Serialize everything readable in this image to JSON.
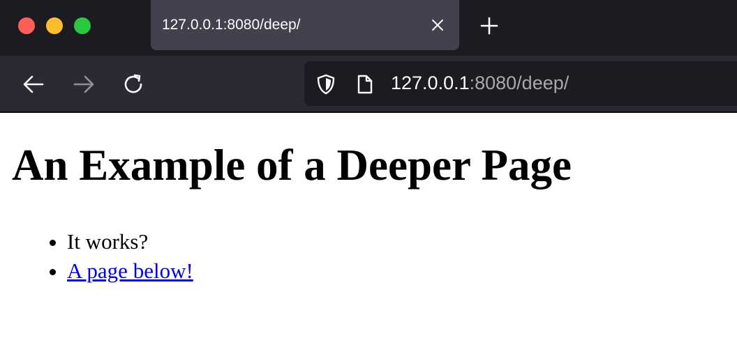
{
  "browser": {
    "tab": {
      "title": "127.0.0.1:8080/deep/"
    },
    "url": {
      "host": "127.0.0.1",
      "rest": ":8080/deep/"
    },
    "icons": {
      "close_window": "close-window-icon",
      "minimize_window": "minimize-window-icon",
      "maximize_window": "maximize-window-icon",
      "tab_close": "close-icon",
      "new_tab": "plus-icon",
      "back": "arrow-left-icon",
      "forward": "arrow-right-icon",
      "reload": "reload-icon",
      "shield": "shield-icon",
      "page": "page-icon"
    },
    "colors": {
      "tabbar_bg": "#1c1b22",
      "active_tab_bg": "#42414d",
      "navbar_bg": "#2b2a33",
      "close": "#ff5f57",
      "minimize": "#febc2e",
      "maximize": "#28c840",
      "link": "#0000ee"
    }
  },
  "page": {
    "heading": "An Example of a Deeper Page",
    "items": [
      {
        "text": "It works?"
      },
      {
        "link_text": "A page below!"
      }
    ]
  }
}
